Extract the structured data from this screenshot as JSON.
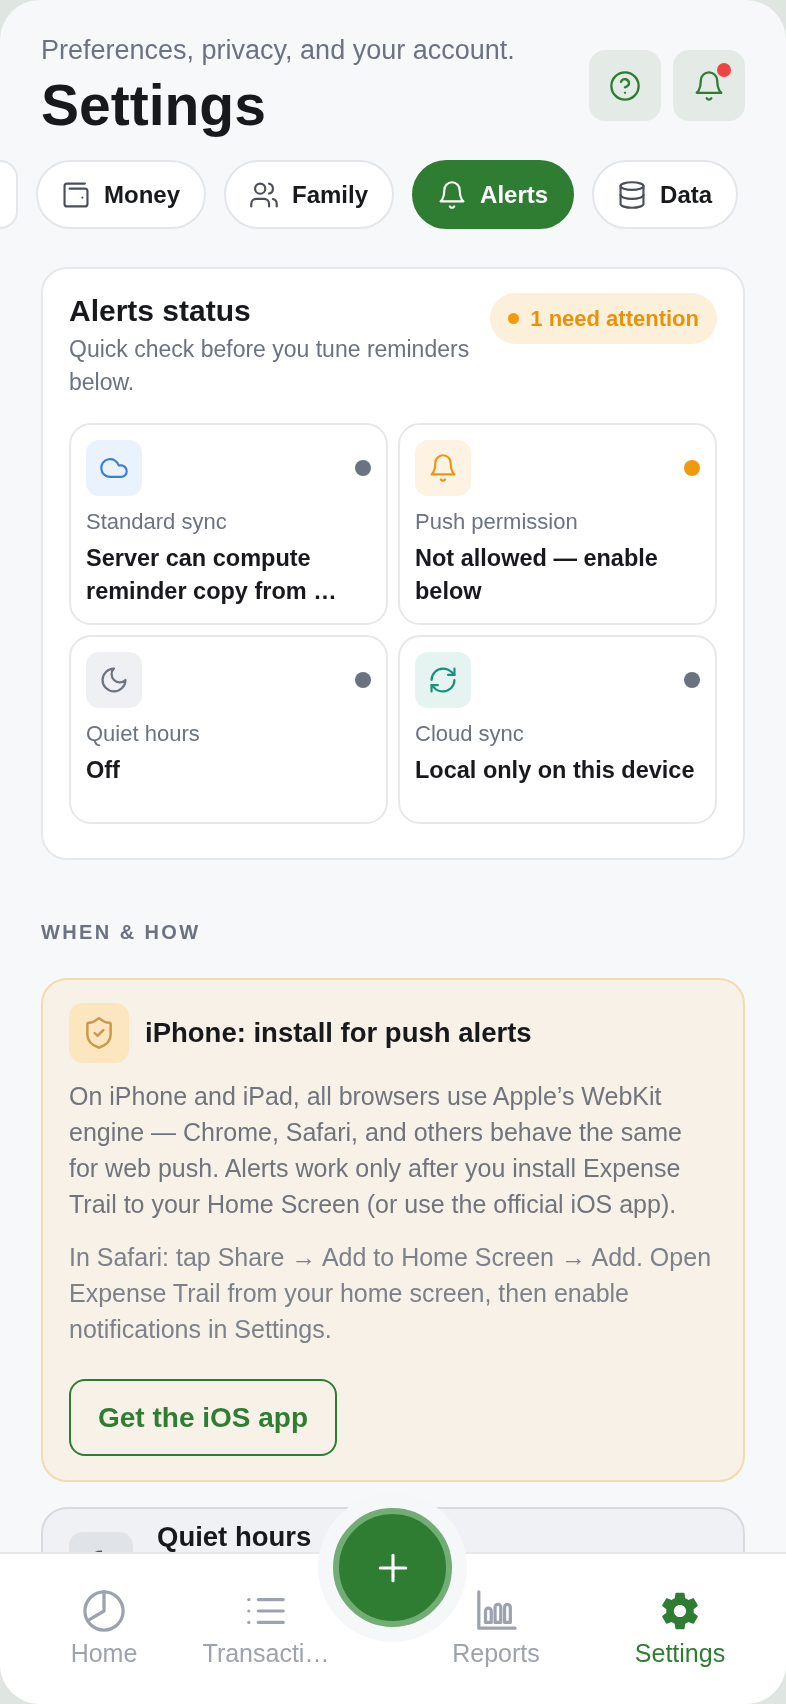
{
  "header": {
    "subtitle": "Preferences, privacy, and your account.",
    "title": "Settings",
    "actions": [
      {
        "kind": "help"
      },
      {
        "kind": "notifications",
        "unread": true
      }
    ]
  },
  "tabs": [
    {
      "label": "Money",
      "selected": false
    },
    {
      "label": "Family",
      "selected": false
    },
    {
      "label": "Alerts",
      "selected": true
    },
    {
      "label": "Data",
      "selected": false
    }
  ],
  "status_card": {
    "title": "Alerts status",
    "subtitle": "Quick check before you tune reminders below.",
    "badge": "1 need attention",
    "tiles": [
      {
        "label": "Standard sync",
        "value": "Server can compute reminder copy from …",
        "color": "#6b7280"
      },
      {
        "label": "Push permission",
        "value": "Not allowed — enable below",
        "color": "#f09a0e"
      },
      {
        "label": "Quiet hours",
        "value": "Off",
        "color": "#6b7280"
      },
      {
        "label": "Cloud sync",
        "value": "Local only on this device",
        "color": "#6b7280"
      }
    ]
  },
  "section_label": "WHEN & HOW",
  "install_card": {
    "title": "iPhone: install for push alerts",
    "paragraphs": [
      "On iPhone and iPad, all browsers use Apple’s WebKit engine — Chrome, Safari, and others behave the same for web push. Alerts work only after you install Expense Trail to your Home Screen (or use the official iOS app).",
      "In Safari: tap Share → Add to Home Screen → Add. Open Expense Trail from your home screen, then enable notifications in Settings."
    ],
    "button": "Get the iOS app"
  },
  "quiet_hours_card": {
    "title": "Quiet hours"
  },
  "bottom_nav": [
    {
      "label": "Home",
      "selected": false
    },
    {
      "label": "Transacti…",
      "selected": false
    },
    {
      "label": "Reports",
      "selected": false
    },
    {
      "label": "Settings",
      "selected": true
    }
  ]
}
